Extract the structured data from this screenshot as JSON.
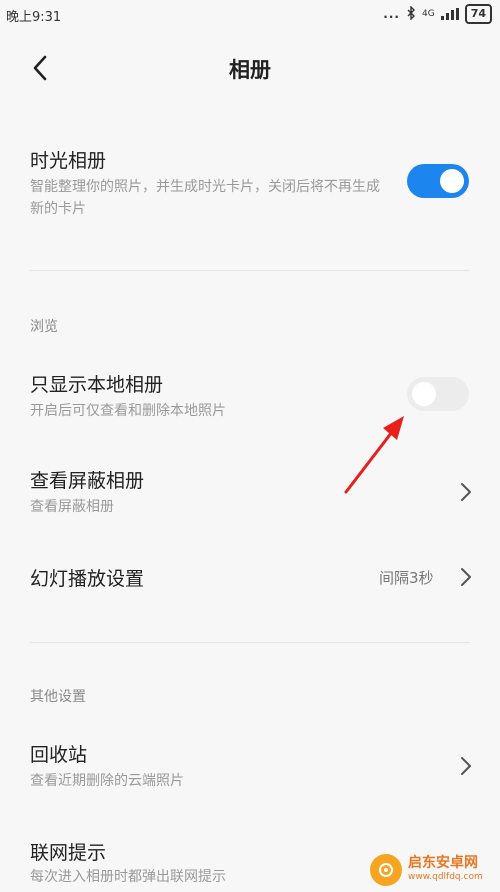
{
  "status_bar": {
    "time": "晚上9:31",
    "dots": "...",
    "network": "4G",
    "battery": "74"
  },
  "header": {
    "title": "相册"
  },
  "items": {
    "time_album": {
      "title": "时光相册",
      "desc": "智能整理你的照片，并生成时光卡片，关闭后将不再生成新的卡片",
      "enabled": true
    },
    "local_only": {
      "title": "只显示本地相册",
      "desc": "开启后可仅查看和删除本地照片",
      "enabled": false
    },
    "hidden_album": {
      "title": "查看屏蔽相册",
      "desc": "查看屏蔽相册"
    },
    "slideshow": {
      "title": "幻灯播放设置",
      "value": "间隔3秒"
    },
    "recycle_bin": {
      "title": "回收站",
      "desc": "查看近期删除的云端照片"
    },
    "network_prompt": {
      "title": "联网提示",
      "desc": "每次进入相册时都弹出联网提示"
    }
  },
  "sections": {
    "browse": "浏览",
    "other": "其他设置"
  },
  "watermark": {
    "title": "启东安卓网",
    "url": "www.qdlfdq.com"
  },
  "colors": {
    "accent": "#1c86ee",
    "annotation": "#e8201c"
  }
}
